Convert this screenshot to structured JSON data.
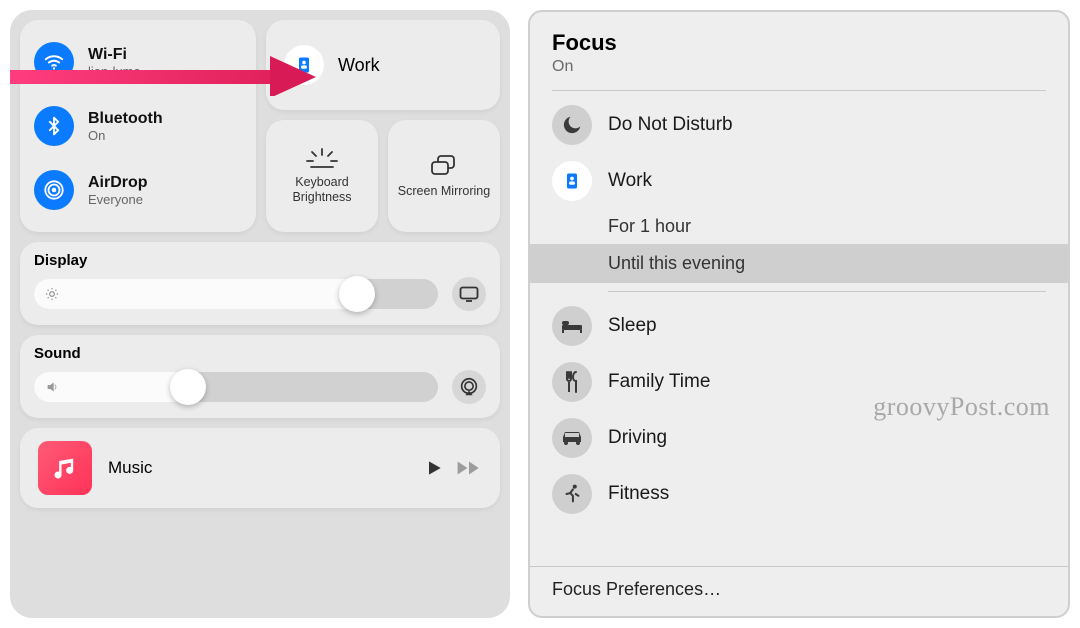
{
  "control_center": {
    "wifi": {
      "title": "Wi-Fi",
      "sub": "lion-luma"
    },
    "bluetooth": {
      "title": "Bluetooth",
      "sub": "On"
    },
    "airdrop": {
      "title": "AirDrop",
      "sub": "Everyone"
    },
    "focus": {
      "label": "Work"
    },
    "keyboard_brightness": {
      "label": "Keyboard Brightness"
    },
    "screen_mirroring": {
      "label": "Screen Mirroring"
    },
    "display": {
      "title": "Display",
      "value_pct": 80
    },
    "sound": {
      "title": "Sound",
      "value_pct": 38
    },
    "music": {
      "label": "Music"
    }
  },
  "focus_panel": {
    "title": "Focus",
    "status": "On",
    "modes": {
      "dnd": {
        "label": "Do Not Disturb"
      },
      "work": {
        "label": "Work",
        "options": {
          "hour": "For 1 hour",
          "evening": "Until this evening"
        },
        "selected": "evening"
      },
      "sleep": {
        "label": "Sleep"
      },
      "family": {
        "label": "Family Time"
      },
      "driving": {
        "label": "Driving"
      },
      "fitness": {
        "label": "Fitness"
      }
    },
    "preferences_label": "Focus Preferences…"
  },
  "watermark": "groovyPost.com"
}
